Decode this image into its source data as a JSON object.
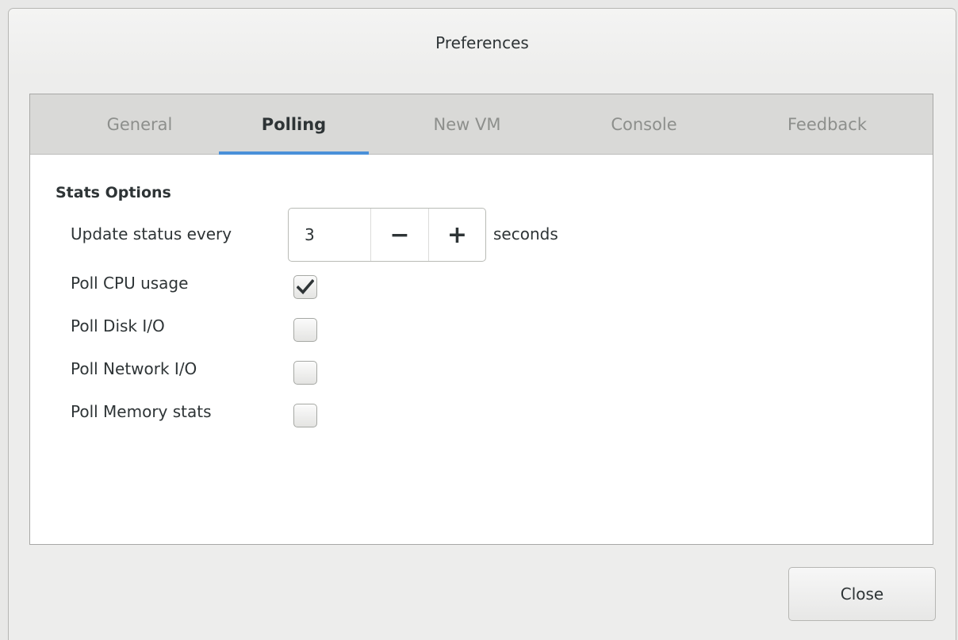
{
  "window": {
    "title": "Preferences"
  },
  "tabs": [
    {
      "label": "General",
      "active": false
    },
    {
      "label": "Polling",
      "active": true
    },
    {
      "label": "New VM",
      "active": false
    },
    {
      "label": "Console",
      "active": false
    },
    {
      "label": "Feedback",
      "active": false
    }
  ],
  "stats": {
    "section_title": "Stats Options",
    "update_label": "Update status every",
    "update_value": "3",
    "decrement_symbol": "−",
    "increment_symbol": "+",
    "update_unit": "seconds",
    "options": [
      {
        "label": "Poll CPU usage",
        "checked": true
      },
      {
        "label": "Poll Disk I/O",
        "checked": false
      },
      {
        "label": "Poll Network I/O",
        "checked": false
      },
      {
        "label": "Poll Memory stats",
        "checked": false
      }
    ]
  },
  "footer": {
    "close_label": "Close"
  },
  "colors": {
    "accent": "#4a90d9",
    "text": "#2e3436",
    "inactive_tab_text": "#8d8f8c"
  },
  "icons": {
    "checked": "checkmark-icon"
  }
}
